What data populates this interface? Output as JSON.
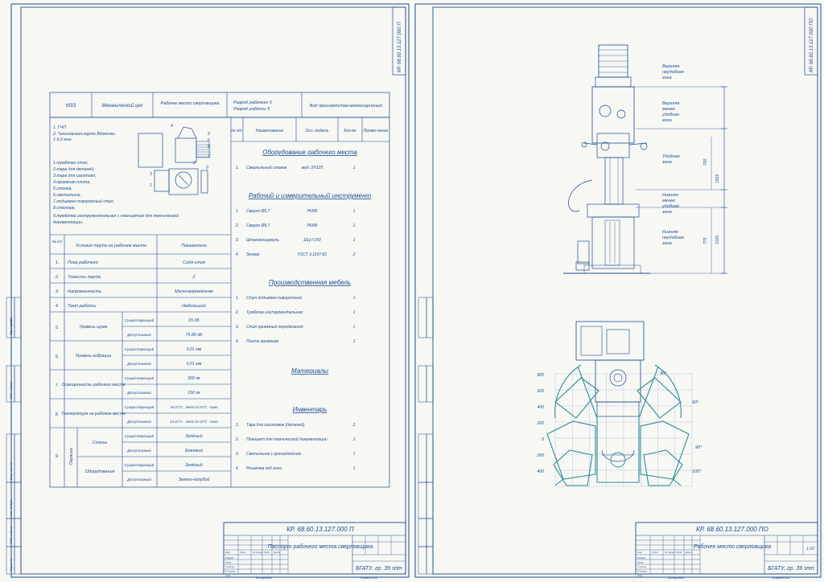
{
  "sheet1": {
    "code_rot": "КР. 68.60.13.127.000 П",
    "header": {
      "plant": "МЗЗ",
      "shop": "Механический цех",
      "workplace": "Рабочее место сверловщика",
      "grade_worker": "Разряд рабочего  5",
      "grade_work": "Разряд работы  5",
      "production": "Вид производства-мелкосерийный"
    },
    "legend_lines": [
      "1. ГЧП",
      "2. Техническая карта Вдоеочки",
      "    1-5,5 мин",
      "1.тумбочки стол,",
      "2.тара для деталей,",
      "3.тара для изготовл,",
      "4.приемная плита,",
      "5.станок,",
      "6.светильник,",
      "7.подъемно-поворотный стул,",
      "8.стеллаж,",
      "9.тумбочка инструментальная с планшетом для технической",
      "    документации."
    ],
    "equip_head": [
      "№ п/п",
      "Наименование",
      "Осн. модель",
      "Кол-во",
      "Приме-чание"
    ],
    "conditions_head": [
      "№ п/п",
      "Условия труда на рабочем месте",
      "Показатели"
    ],
    "conditions": [
      {
        "n": "1.",
        "name": "Поза рабочего",
        "val": "Сидя-стоя"
      },
      {
        "n": "2.",
        "name": "Тяжесть труда",
        "val": "2"
      },
      {
        "n": "3.",
        "name": "Напряженность",
        "val": "Малонапряжённая"
      },
      {
        "n": "4.",
        "name": "Темп работы",
        "val": "Небольшой"
      }
    ],
    "conditions_split": [
      {
        "n": "5.",
        "name": "Уровень шума",
        "rows": [
          {
            "k": "Существующий",
            "v": "65 дБ"
          },
          {
            "k": "Допустимый",
            "v": "75-80 дБ"
          }
        ]
      },
      {
        "n": "6.",
        "name": "Уровень вибрации",
        "rows": [
          {
            "k": "Существующий",
            "v": "0,01 мм"
          },
          {
            "k": "Допустимый",
            "v": "0,01 мм"
          }
        ]
      },
      {
        "n": "7.",
        "name": "Освещенность рабочего места",
        "rows": [
          {
            "k": "Существующий",
            "v": "300 лк"
          },
          {
            "k": "Допустимый",
            "v": "150 лк"
          }
        ]
      },
      {
        "n": "8.",
        "name": "Температура на рабочем месте",
        "rows": [
          {
            "k": "Существующий",
            "v": "16-21°С - лето  22-24°С - зима"
          },
          {
            "k": "Допустимый",
            "v": "14-21°С - лето  22-24°С - зима"
          }
        ]
      }
    ],
    "cond9": {
      "n": "9.",
      "group": "Окраска",
      "items": [
        {
          "name": "Стены",
          "rows": [
            {
              "k": "Существующий",
              "v": "Зелёный"
            },
            {
              "k": "Допустимый",
              "v": "Бежевый"
            }
          ]
        },
        {
          "name": "Оборудования",
          "rows": [
            {
              "k": "Существующий",
              "v": "Зелёный"
            },
            {
              "k": "Допустимый",
              "v": "Зелено-голубой"
            }
          ]
        }
      ]
    },
    "sections": [
      {
        "title": "Оборудование рабочего места",
        "items": [
          {
            "n": "1.",
            "name": "Сверлильный станок",
            "model": "мод. 2Н125",
            "qty": "1"
          }
        ]
      },
      {
        "title": "Рабочий и измерительный инструмент",
        "items": [
          {
            "n": "1.",
            "name": "Сверло Ø6,7",
            "model": "Р6М5",
            "qty": "1"
          },
          {
            "n": "2.",
            "name": "Сверло Ø8,7",
            "model": "Р6М5",
            "qty": "1"
          },
          {
            "n": "3.",
            "name": "Штангенциркуль",
            "model": "ШЦ-I-150",
            "qty": "1"
          },
          {
            "n": "4.",
            "name": "Зенкер",
            "model": "ГОСТ 3.1107-81",
            "qty": "2"
          }
        ]
      },
      {
        "title": "Производственная мебель",
        "items": [
          {
            "n": "1.",
            "name": "Стул подъемно-поворотный",
            "model": "",
            "qty": "1"
          },
          {
            "n": "2.",
            "name": "Тумбочка инструментальная",
            "model": "",
            "qty": "1"
          },
          {
            "n": "3.",
            "name": "Стол приемный передвижной",
            "model": "",
            "qty": "1"
          },
          {
            "n": "4.",
            "name": "Плита приемная",
            "model": "",
            "qty": "1"
          }
        ]
      },
      {
        "title": "Материалы",
        "items": []
      },
      {
        "title": "Инвентарь",
        "items": [
          {
            "n": "1.",
            "name": "Тара для изготовок (деталей)",
            "model": "",
            "qty": "2"
          },
          {
            "n": "2.",
            "name": "Планшет для технической документации",
            "model": "",
            "qty": "1"
          },
          {
            "n": "3.",
            "name": "Светильник с кронштейном",
            "model": "",
            "qty": "1"
          },
          {
            "n": "4.",
            "name": "Решетка под ноги",
            "model": "",
            "qty": "1"
          }
        ]
      }
    ],
    "stamp": {
      "code": "КР. 68.60.13.127.000 П",
      "title": "Паспорт рабочего места сверловщика",
      "group": "БГАТУ, гр. 39 зпт",
      "sheet": "",
      "mark": "",
      "labels": [
        "Изм.",
        "Лист",
        "№ докум.",
        "Подп.",
        "Дата",
        "Разраб.",
        "Пров.",
        "Т.контр.",
        "Н.контр.",
        "Утв.",
        "Лит.",
        "Масса",
        "Масштаб",
        "Лист",
        "Листов 1"
      ],
      "footer_left": "Копировал",
      "footer_right": "Формат  А4"
    },
    "side_labels": [
      "Инв. № подл.",
      "Подп. и дата",
      "Взам. инв. №",
      "Инв. № дубл.",
      "Подп. и дата",
      "Справ. №",
      "Перв. примен."
    ]
  },
  "sheet2": {
    "code_rot": "КР. 68.60.13.127.000 ПО",
    "zones": [
      "Верхняя неудобная зона",
      "Верхняя менее удобная зона",
      "Удобная зона",
      "Нижняя менее удобная зона",
      "Нижняя неудобная зона"
    ],
    "dims": [
      "1925",
      "700",
      "775",
      "1025"
    ],
    "plan_y_ticks": [
      "800",
      "600",
      "400",
      "200",
      "0",
      "200",
      "400"
    ],
    "angles": [
      "30°",
      "60°",
      "90°",
      "105°"
    ],
    "stamp": {
      "code": "КР. 68.60.13.127.000 ПО",
      "title": "Рабочее место сверловщика",
      "group": "БГАТУ, гр. 39 зпт",
      "mark": "",
      "scale": "1:10",
      "footer_left": "Копировал",
      "footer_right": "Формат  А4"
    }
  }
}
